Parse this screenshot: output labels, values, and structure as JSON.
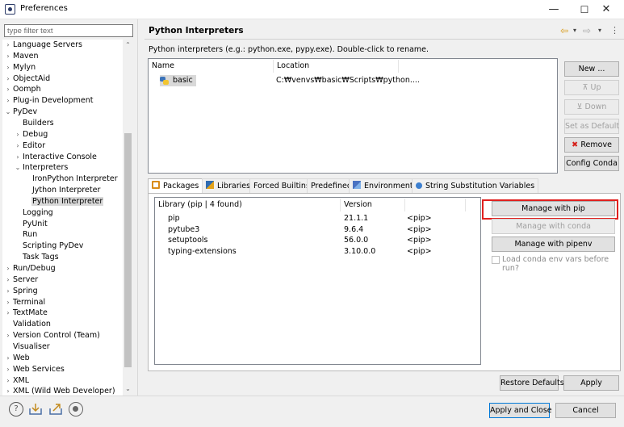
{
  "window": {
    "title": "Preferences",
    "minimize": "—",
    "maximize": "☐",
    "close": "✕"
  },
  "filter": {
    "placeholder": "type filter text",
    "value": ""
  },
  "tree": [
    {
      "label": "Language Servers",
      "indent": 0,
      "arrow": "›"
    },
    {
      "label": "Maven",
      "indent": 0,
      "arrow": "›"
    },
    {
      "label": "Mylyn",
      "indent": 0,
      "arrow": "›"
    },
    {
      "label": "ObjectAid",
      "indent": 0,
      "arrow": "›"
    },
    {
      "label": "Oomph",
      "indent": 0,
      "arrow": "›"
    },
    {
      "label": "Plug-in Development",
      "indent": 0,
      "arrow": "›"
    },
    {
      "label": "PyDev",
      "indent": 0,
      "arrow": "⌄"
    },
    {
      "label": "Builders",
      "indent": 1,
      "arrow": ""
    },
    {
      "label": "Debug",
      "indent": 1,
      "arrow": "›"
    },
    {
      "label": "Editor",
      "indent": 1,
      "arrow": "›"
    },
    {
      "label": "Interactive Console",
      "indent": 1,
      "arrow": "›"
    },
    {
      "label": "Interpreters",
      "indent": 1,
      "arrow": "⌄"
    },
    {
      "label": "IronPython Interpreter",
      "indent": 2,
      "arrow": ""
    },
    {
      "label": "Jython Interpreter",
      "indent": 2,
      "arrow": ""
    },
    {
      "label": "Python Interpreter",
      "indent": 2,
      "arrow": "",
      "selected": true
    },
    {
      "label": "Logging",
      "indent": 1,
      "arrow": ""
    },
    {
      "label": "PyUnit",
      "indent": 1,
      "arrow": ""
    },
    {
      "label": "Run",
      "indent": 1,
      "arrow": ""
    },
    {
      "label": "Scripting PyDev",
      "indent": 1,
      "arrow": ""
    },
    {
      "label": "Task Tags",
      "indent": 1,
      "arrow": ""
    },
    {
      "label": "Run/Debug",
      "indent": 0,
      "arrow": "›"
    },
    {
      "label": "Server",
      "indent": 0,
      "arrow": "›"
    },
    {
      "label": "Spring",
      "indent": 0,
      "arrow": "›"
    },
    {
      "label": "Terminal",
      "indent": 0,
      "arrow": "›"
    },
    {
      "label": "TextMate",
      "indent": 0,
      "arrow": "›"
    },
    {
      "label": "Validation",
      "indent": 0,
      "arrow": ""
    },
    {
      "label": "Version Control (Team)",
      "indent": 0,
      "arrow": "›"
    },
    {
      "label": "Visualiser",
      "indent": 0,
      "arrow": ""
    },
    {
      "label": "Web",
      "indent": 0,
      "arrow": "›"
    },
    {
      "label": "Web Services",
      "indent": 0,
      "arrow": "›"
    },
    {
      "label": "XML",
      "indent": 0,
      "arrow": "›"
    },
    {
      "label": "XML (Wild Web Developer)",
      "indent": 0,
      "arrow": "›"
    }
  ],
  "page": {
    "heading": "Python Interpreters",
    "description": "Python interpreters (e.g.: python.exe, pypy.exe).   Double-click to rename."
  },
  "interpreters": {
    "col_name": "Name",
    "col_location": "Location",
    "rows": [
      {
        "name": "basic",
        "location": "C:₩venvs₩basic₩Scripts₩python...."
      }
    ]
  },
  "interp_buttons": {
    "new": "New ...",
    "up": "Up",
    "down": "Down",
    "set_default": "Set as Default",
    "remove": "Remove",
    "config_conda": "Config Conda"
  },
  "tabs": [
    "Packages",
    "Libraries",
    "Forced Builtins",
    "Predefined",
    "Environment",
    "String Substitution Variables"
  ],
  "packages": {
    "col_library": "Library (pip | 4 found)",
    "col_version": "Version",
    "rows": [
      {
        "name": "pip",
        "version": "21.1.1",
        "source": "<pip>"
      },
      {
        "name": "pytube3",
        "version": "9.6.4",
        "source": "<pip>"
      },
      {
        "name": "setuptools",
        "version": "56.0.0",
        "source": "<pip>"
      },
      {
        "name": "typing-extensions",
        "version": "3.10.0.0",
        "source": "<pip>"
      }
    ]
  },
  "pkg_buttons": {
    "manage_pip": "Manage with pip",
    "manage_conda": "Manage with conda",
    "manage_pipenv": "Manage with pipenv",
    "load_conda": "Load conda env vars before run?"
  },
  "footer": {
    "restore_defaults": "Restore Defaults",
    "apply": "Apply",
    "apply_close": "Apply and Close",
    "cancel": "Cancel"
  },
  "colors": {
    "highlight_box": "#e0201e",
    "accent": "#0078d7"
  }
}
